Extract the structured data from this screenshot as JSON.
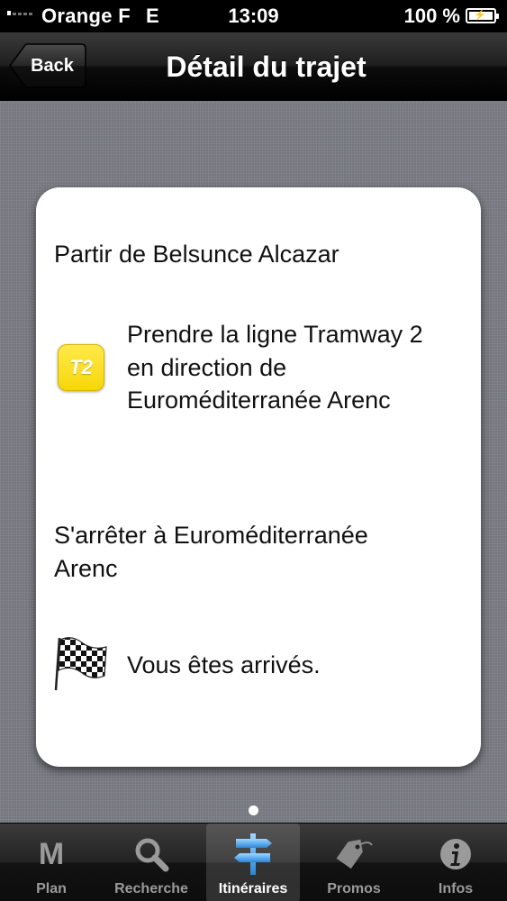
{
  "status_bar": {
    "carrier": "Orange F",
    "network": "E",
    "time": "13:09",
    "battery": "100 %"
  },
  "nav": {
    "back_label": "Back",
    "title": "Détail du trajet"
  },
  "steps": {
    "depart": "Partir de Belsunce Alcazar",
    "line_badge": "T2",
    "take_line_1": "Prendre la ligne Tramway 2",
    "take_line_2": "en direction de",
    "take_line_3": "Euroméditerranée Arenc",
    "stop_1": "S'arrêter à Euroméditerranée",
    "stop_2": "Arenc",
    "arrival": "Vous êtes arrivés."
  },
  "colors": {
    "line_badge": "#f6d70a",
    "tabbar_active": "#ffffff",
    "tabbar_inactive": "#9a9a9a"
  },
  "tabs": [
    {
      "label": "Plan",
      "icon": "m-letter-icon"
    },
    {
      "label": "Recherche",
      "icon": "search-icon"
    },
    {
      "label": "Itinéraires",
      "icon": "signpost-icon",
      "active": true
    },
    {
      "label": "Promos",
      "icon": "price-tag-icon"
    },
    {
      "label": "Infos",
      "icon": "info-icon"
    }
  ]
}
